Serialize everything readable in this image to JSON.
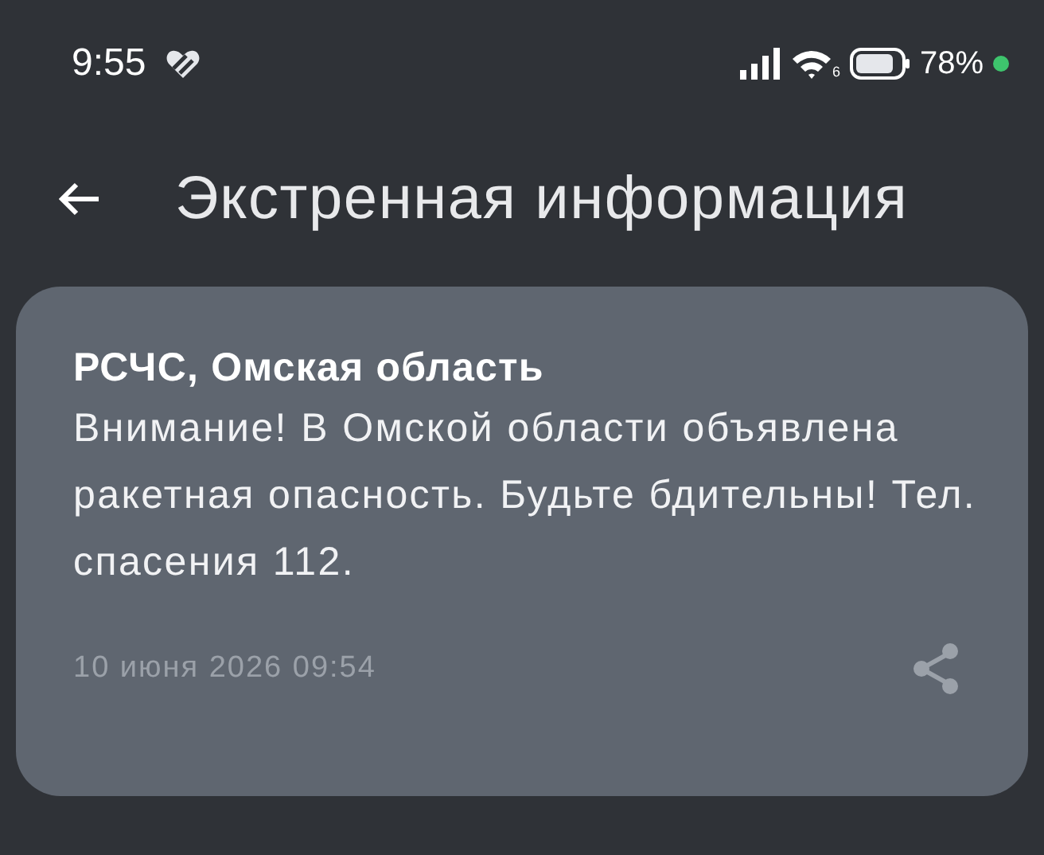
{
  "status_bar": {
    "time": "9:55",
    "wifi_badge": "6",
    "battery": "78%"
  },
  "header": {
    "title": "Экстренная информация"
  },
  "message": {
    "sender": "РСЧС, Омская область",
    "body": "Внимание! В Омской области объявлена ракетная опасность. Будьте бдительны! Тел. спасения 112.",
    "timestamp": "10 июня 2026 09:54"
  }
}
